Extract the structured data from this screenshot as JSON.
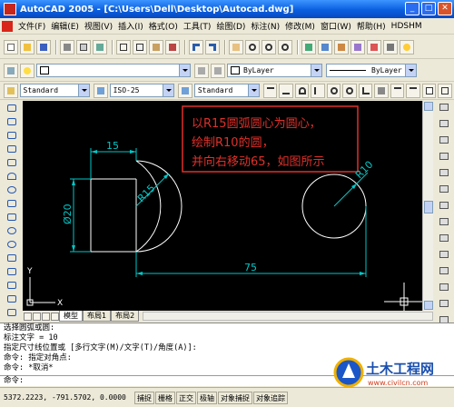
{
  "window": {
    "title": "AutoCAD 2005 - [C:\\Users\\Dell\\Desktop\\Autocad.dwg]",
    "min": "_",
    "max": "□",
    "close": "✕"
  },
  "menu": [
    "文件(F)",
    "编辑(E)",
    "视图(V)",
    "插入(I)",
    "格式(O)",
    "工具(T)",
    "绘图(D)",
    "标注(N)",
    "修改(M)",
    "窗口(W)",
    "帮助(H)",
    "HDSHM"
  ],
  "properties": {
    "color": "ByLayer",
    "linetype": "ByLayer",
    "lineweight": "ByLayer"
  },
  "styles": {
    "text_style": "Standard",
    "dim_style": "ISO-25",
    "table_style": "Standard"
  },
  "annotation": {
    "line1": "以R15圆弧圆心为圆心，",
    "line2": "绘制R10的圆，",
    "line3": "并向右移动65，如图所示",
    "color": "#e0302a"
  },
  "drawing": {
    "dim_top": "15",
    "dim_left": "Ø20",
    "dim_radius_arc": "R15",
    "dim_radius_circle": "R10",
    "dim_bottom": "75",
    "ucs_x": "X",
    "ucs_y": "Y"
  },
  "tabs": [
    "模型",
    "布局1",
    "布局2"
  ],
  "command_lines": [
    "选择圆弧或圆:",
    "标注文字 = 10",
    "指定尺寸线位置或 [多行文字(M)/文字(T)/角度(A)]:",
    "命令: 指定对角点:",
    "命令: *取消*",
    "命令:"
  ],
  "status": {
    "coords": "5372.2223, -791.5702, 0.0000",
    "buttons": [
      "捕捉",
      "栅格",
      "正交",
      "极轴",
      "对象捕捉",
      "对象追踪"
    ]
  },
  "watermark": {
    "brand": "土木工程网",
    "url": "www.civilcn.com"
  },
  "colors": {
    "canvas": "#000000",
    "geometry": "#ffffff",
    "dimension": "#00c8c8",
    "annotation_border": "#e0302a"
  }
}
